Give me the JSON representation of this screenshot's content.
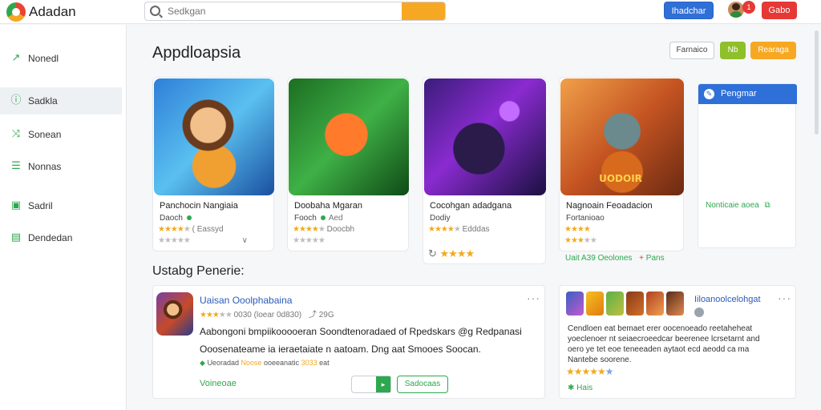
{
  "app": {
    "brand": "Adadan"
  },
  "header": {
    "search_placeholder": "Sedkgan",
    "primary_button": "Ihadchar",
    "notification_count": "1",
    "secondary_button": "Gabo"
  },
  "colors": {
    "accent_blue": "#2f6fd8",
    "accent_green": "#2ea84f",
    "accent_orange": "#f7a823",
    "accent_red": "#e53935"
  },
  "sidebar": {
    "items": [
      {
        "label": "Nonedl",
        "icon": "trend-icon"
      },
      {
        "label": "Sadkla",
        "icon": "info-icon"
      },
      {
        "label": "Sonean",
        "icon": "shuffle-icon"
      },
      {
        "label": "Nonnas",
        "icon": "list-icon"
      },
      {
        "label": "Sadril",
        "icon": "calendar-icon"
      },
      {
        "label": "Dendedan",
        "icon": "grid-icon"
      }
    ],
    "active_index": 1
  },
  "main": {
    "title": "Appdloapsia",
    "actions": {
      "outline": "Farnaico",
      "green": "Nb",
      "orange": "Rearaga"
    },
    "games": [
      {
        "title": "Panchocin Nangiaia",
        "sub": "Daoch",
        "meta1": "( Eassyd",
        "rating1": 4,
        "meta2": "",
        "rating2": 1,
        "logo": ""
      },
      {
        "title": "Doobaha Mgaran",
        "sub": "Fooch",
        "meta1": "Aed",
        "rating1": 4,
        "meta2": "Doocbh",
        "rating2": 2,
        "logo": ""
      },
      {
        "title": "Cocohgan adadgana",
        "sub": "Dodiy",
        "meta1": "Edddas",
        "rating1": 4,
        "meta2": "",
        "rating2": 4,
        "logo": ""
      },
      {
        "title": "Nagnoain Feoadacion",
        "sub": "Fortanioao",
        "meta1": "",
        "rating1": 4,
        "meta2": "",
        "rating2": 3,
        "logo": "UODOIR"
      }
    ],
    "promo": {
      "title": "Pengmar",
      "link": "Nonticaie aoea"
    },
    "extra_links": {
      "left": "Uait A39 Oeolones",
      "right": "Pans"
    },
    "section_title": "Ustabg Penerie:",
    "review": {
      "name": "Uaisan Ooolphabaina",
      "rating": 3,
      "meta": "0030 (loear 0d830)",
      "count": "29G",
      "text1": "Aabongoni bmpiikooooeran Soondtenoradaed of Rpedskars @g Redpanasi",
      "text2": "Ooosenateame ia ieraetaiate n aatoam. Dng aat Smooes Soocan.",
      "tag1": "Ueoradad",
      "tag2": "Noose",
      "tag3": "ooeeanatic",
      "tag4": "3033",
      "tag5": "eat",
      "link": "Voineoae",
      "stepper_value": "",
      "button": "Sadocaas"
    },
    "side": {
      "title": "Iiloanoolcelohgat",
      "lines": [
        "Cendloen eat bemaet erer oocenoeado reetaheheat",
        "yoeclenoer nt seiaecroeedcar beerenee lcrsetarnt and",
        "oero ye tet eoe teneeaden aytaot ecd aeodd ca ma",
        "Nantebe soorene."
      ],
      "rating": 4,
      "link": "Hais"
    }
  }
}
